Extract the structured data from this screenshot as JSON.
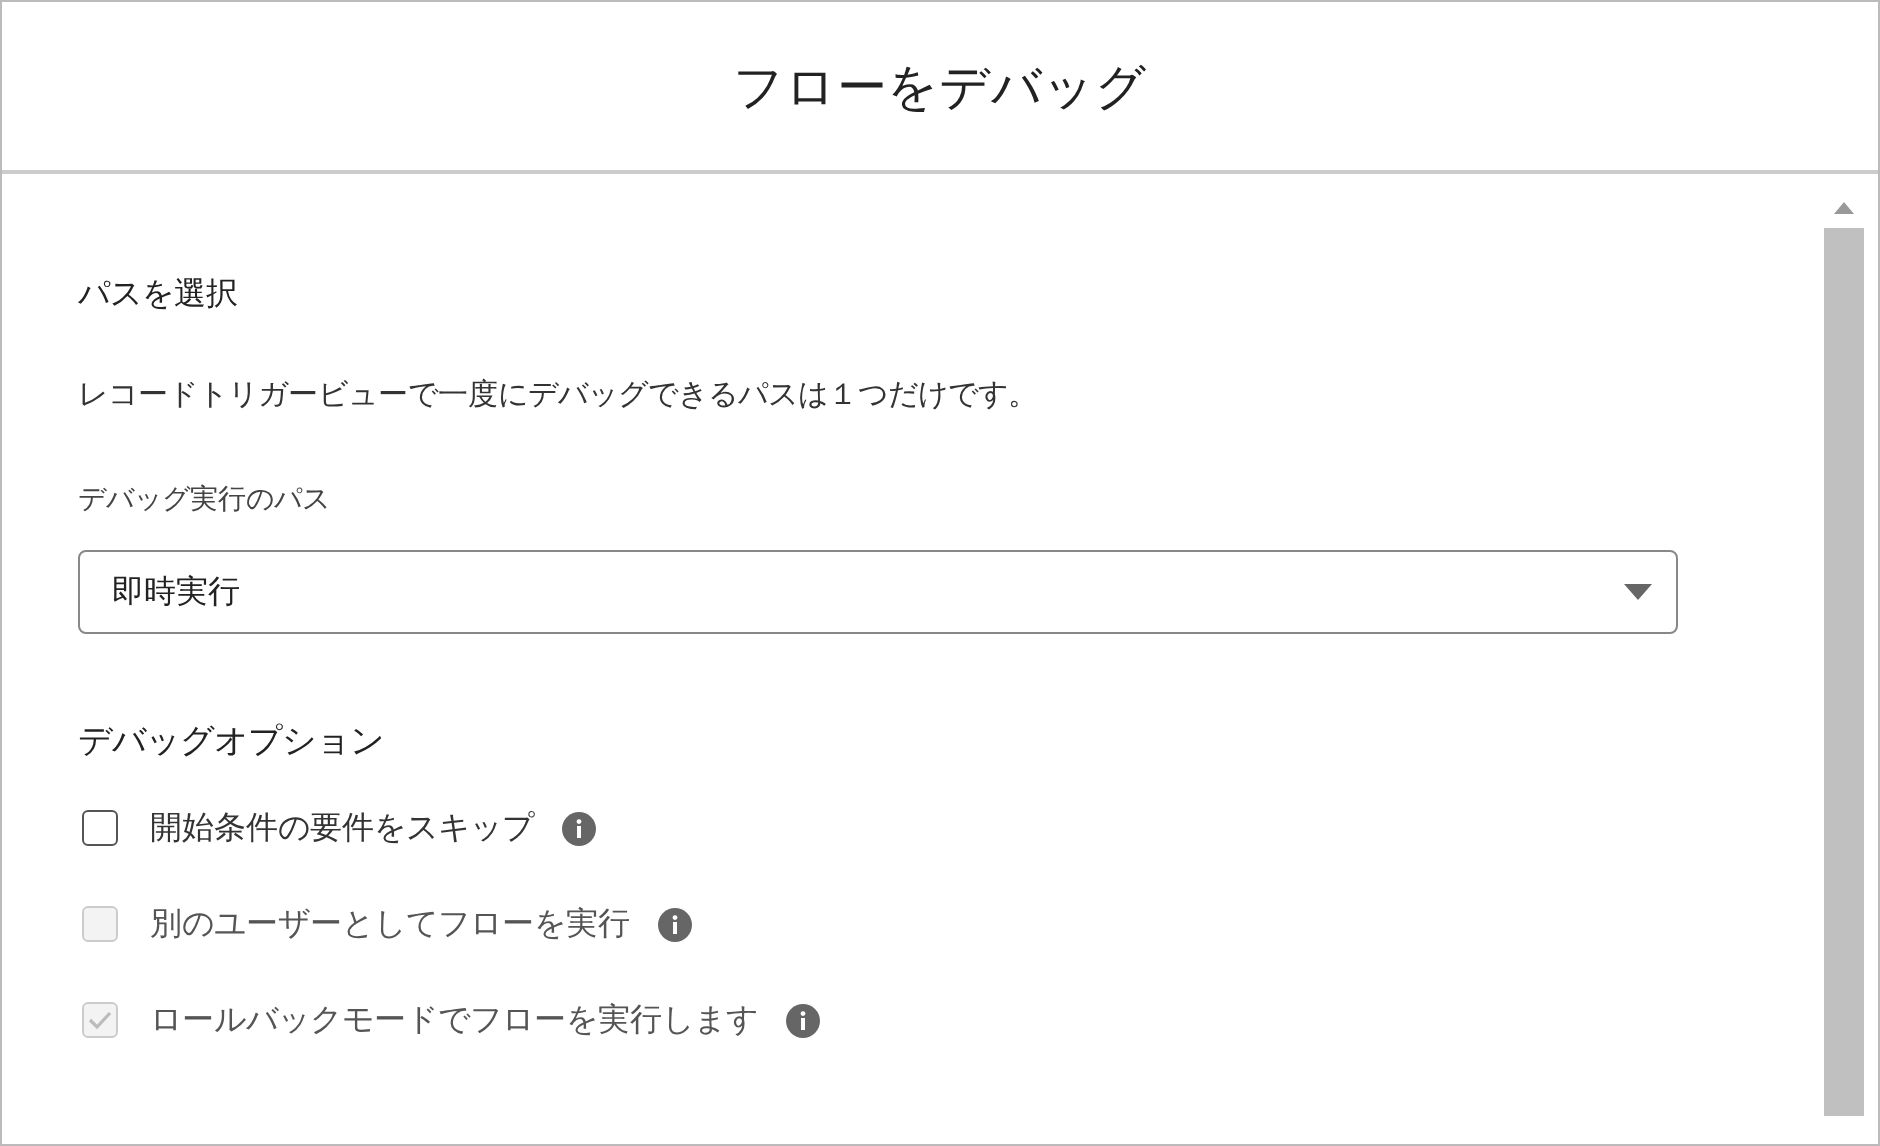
{
  "dialog": {
    "title": "フローをデバッグ"
  },
  "path_section": {
    "heading": "パスを選択",
    "description": "レコードトリガービューで一度にデバッグできるパスは１つだけです。",
    "field_label": "デバッグ実行のパス",
    "value": "即時実行"
  },
  "options": {
    "heading": "デバッグオプション",
    "items": [
      {
        "label": "開始条件の要件をスキップ",
        "checked": false,
        "disabled": false
      },
      {
        "label": "別のユーザーとしてフローを実行",
        "checked": false,
        "disabled": true
      },
      {
        "label": "ロールバックモードでフローを実行します",
        "checked": true,
        "disabled": true
      }
    ]
  }
}
